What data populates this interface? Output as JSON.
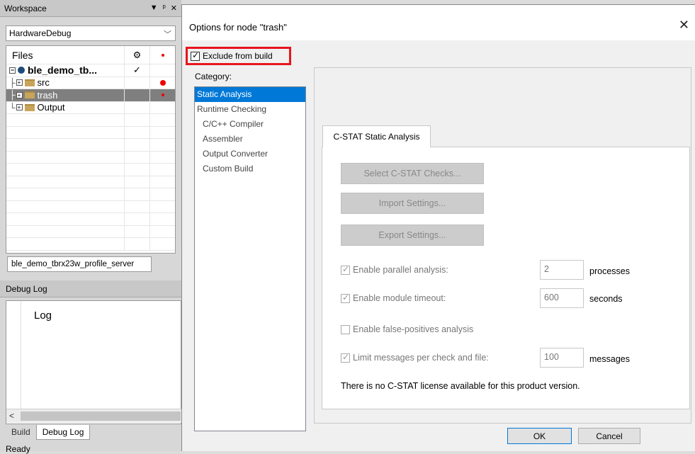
{
  "workspace": {
    "title": "Workspace",
    "title_buttons": [
      "▼",
      "ᵖ",
      "✕"
    ],
    "config": "HardwareDebug",
    "files_header": "Files",
    "tree": [
      {
        "label": "ble_demo_tb...",
        "bold": true,
        "check": "✓",
        "dot": ""
      },
      {
        "label": "src",
        "dot": "big"
      },
      {
        "label": "trash",
        "dot": "small",
        "selected": true
      },
      {
        "label": "Output",
        "dot": ""
      }
    ],
    "project_tab": "ble_demo_tbrx23w_profile_server"
  },
  "debug_log": {
    "title": "Debug Log",
    "column": "Log",
    "tabs": [
      "Build",
      "Debug Log"
    ],
    "status": "Ready"
  },
  "dialog": {
    "title": "Options for node \"trash\"",
    "close": "✕",
    "exclude_label": "Exclude from build",
    "category_label": "Category:",
    "categories": [
      {
        "label": "Static Analysis",
        "selected": true,
        "sub": false
      },
      {
        "label": "Runtime Checking",
        "sub": false
      },
      {
        "label": "C/C++ Compiler",
        "sub": true
      },
      {
        "label": "Assembler",
        "sub": true
      },
      {
        "label": "Output Converter",
        "sub": true
      },
      {
        "label": "Custom Build",
        "sub": true
      }
    ],
    "tab": "C-STAT Static Analysis",
    "buttons": [
      "Select C-STAT Checks...",
      "Import Settings...",
      "Export Settings..."
    ],
    "parallel": {
      "label": "Enable parallel analysis:",
      "value": "2",
      "unit": "processes"
    },
    "timeout": {
      "label": "Enable module timeout:",
      "value": "600",
      "unit": "seconds"
    },
    "false_positives": {
      "label": "Enable false-positives analysis"
    },
    "limit": {
      "label": "Limit messages per check and file:",
      "value": "100",
      "unit": "messages"
    },
    "license": "There is no C-STAT license available for this product version.",
    "ok": "OK",
    "cancel": "Cancel"
  },
  "colors": {
    "selection": "#0078d7",
    "highlight_box": "#e8141e",
    "tree_selection": "#7f7f7f"
  }
}
